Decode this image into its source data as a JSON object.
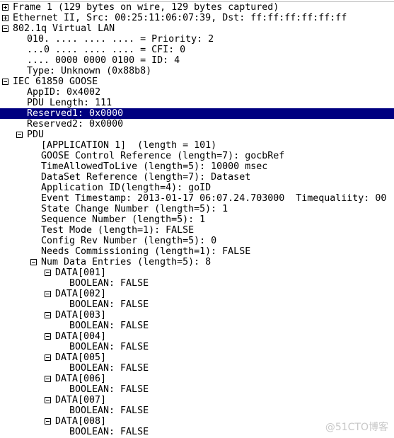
{
  "colors": {
    "selection": "#000080",
    "selection_text": "#ffffff"
  },
  "rows": [
    {
      "level": 0,
      "toggle": "expand",
      "text": "Frame 1 (129 bytes on wire, 129 bytes captured)"
    },
    {
      "level": 0,
      "toggle": "expand",
      "text": "Ethernet II, Src: 00:25:11:06:07:39, Dst: ff:ff:ff:ff:ff:ff"
    },
    {
      "level": 0,
      "toggle": "collapse",
      "text": "802.1q Virtual LAN"
    },
    {
      "level": 1,
      "text": "010. .... .... .... = Priority: 2"
    },
    {
      "level": 1,
      "text": "...0 .... .... .... = CFI: 0"
    },
    {
      "level": 1,
      "text": ".... 0000 0000 0100 = ID: 4"
    },
    {
      "level": 1,
      "text": "Type: Unknown (0x88b8)"
    },
    {
      "level": 0,
      "toggle": "collapse",
      "text": "IEC 61850 GOOSE"
    },
    {
      "level": 1,
      "text": "AppID: 0x4002"
    },
    {
      "level": 1,
      "text": "PDU Length: 111"
    },
    {
      "level": 1,
      "text": "Reserved1: 0x0000",
      "selected": true
    },
    {
      "level": 1,
      "text": "Reserved2: 0x0000"
    },
    {
      "level": 1,
      "toggle": "collapse",
      "text": "PDU"
    },
    {
      "level": 2,
      "text": "[APPLICATION 1]  (length = 101)"
    },
    {
      "level": 2,
      "text": "GOOSE Control Reference (length=7): gocbRef"
    },
    {
      "level": 2,
      "text": "TimeAllowedToLive (length=5): 10000 msec"
    },
    {
      "level": 2,
      "text": "DataSet Reference (length=7): Dataset"
    },
    {
      "level": 2,
      "text": "Application ID(length=4): goID"
    },
    {
      "level": 2,
      "text": "Event Timestamp: 2013-01-17 06:07.24.703000  Timequaliity: 00"
    },
    {
      "level": 2,
      "text": "State Change Number (length=5): 1"
    },
    {
      "level": 2,
      "text": "Sequence Number (length=5): 1"
    },
    {
      "level": 2,
      "text": "Test Mode (length=1): FALSE"
    },
    {
      "level": 2,
      "text": "Config Rev Number (length=5): 0"
    },
    {
      "level": 2,
      "text": "Needs Commissioning (length=1): FALSE"
    },
    {
      "level": 2,
      "toggle": "collapse",
      "text": "Num Data Entries (length=5): 8"
    },
    {
      "level": 3,
      "toggle": "collapse",
      "text": "DATA[001]"
    },
    {
      "level": 4,
      "text": "BOOLEAN: FALSE"
    },
    {
      "level": 3,
      "toggle": "collapse",
      "text": "DATA[002]"
    },
    {
      "level": 4,
      "text": "BOOLEAN: FALSE"
    },
    {
      "level": 3,
      "toggle": "collapse",
      "text": "DATA[003]"
    },
    {
      "level": 4,
      "text": "BOOLEAN: FALSE"
    },
    {
      "level": 3,
      "toggle": "collapse",
      "text": "DATA[004]"
    },
    {
      "level": 4,
      "text": "BOOLEAN: FALSE"
    },
    {
      "level": 3,
      "toggle": "collapse",
      "text": "DATA[005]"
    },
    {
      "level": 4,
      "text": "BOOLEAN: FALSE"
    },
    {
      "level": 3,
      "toggle": "collapse",
      "text": "DATA[006]"
    },
    {
      "level": 4,
      "text": "BOOLEAN: FALSE"
    },
    {
      "level": 3,
      "toggle": "collapse",
      "text": "DATA[007]"
    },
    {
      "level": 4,
      "text": "BOOLEAN: FALSE"
    },
    {
      "level": 3,
      "toggle": "collapse",
      "text": "DATA[008]"
    },
    {
      "level": 4,
      "text": "BOOLEAN: FALSE"
    }
  ],
  "watermark": "@51CTO博客"
}
